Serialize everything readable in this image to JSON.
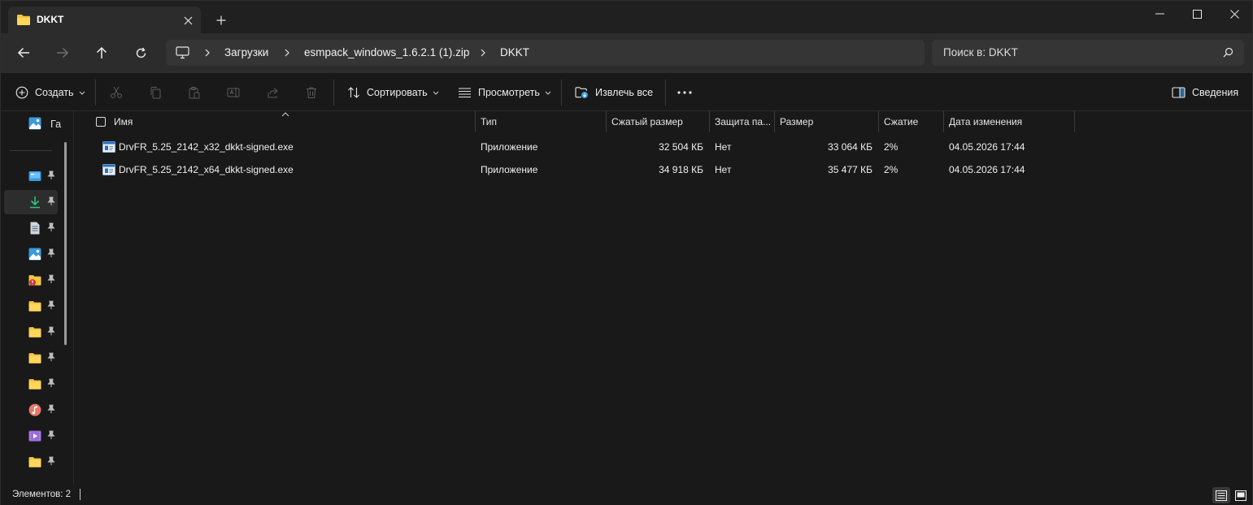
{
  "window": {
    "tab_title": "DKKT",
    "new_tab_symbol": "+"
  },
  "address": {
    "breadcrumbs": [
      "Загрузки",
      "esmpack_windows_1.6.2.1 (1).zip",
      "DKKT"
    ],
    "search_placeholder": "Поиск в: DKKT"
  },
  "commands": {
    "create": "Создать",
    "sort": "Сортировать",
    "view": "Просмотреть",
    "extract_all": "Извлечь все",
    "details": "Сведения"
  },
  "sidebar": {
    "gallery_label": "Га",
    "items": [
      {
        "icon": "desktop-icon",
        "color": "#3a9bdc"
      },
      {
        "icon": "downloads-icon",
        "color": "#2ec27e",
        "active": true
      },
      {
        "icon": "documents-icon",
        "color": "#cfd6e0"
      },
      {
        "icon": "pictures-icon",
        "color": "#3a9bdc"
      },
      {
        "icon": "folder-alert-icon",
        "color": "#f5c542"
      },
      {
        "icon": "folder-icon",
        "color": "#f5c542"
      },
      {
        "icon": "folder-icon",
        "color": "#f5c542"
      },
      {
        "icon": "folder-icon",
        "color": "#f5c542"
      },
      {
        "icon": "folder-icon",
        "color": "#f5c542"
      },
      {
        "icon": "music-icon",
        "color": "#e8786b"
      },
      {
        "icon": "videos-icon",
        "color": "#9b6bdc"
      },
      {
        "icon": "folder-icon",
        "color": "#f5c542"
      }
    ]
  },
  "columns": [
    "Имя",
    "Тип",
    "Сжатый размер",
    "Защита па...",
    "Размер",
    "Сжатие",
    "Дата изменения"
  ],
  "files": [
    {
      "name": "DrvFR_5.25_2142_x32_dkkt-signed.exe",
      "type": "Приложение",
      "packed": "32 504 КБ",
      "protected": "Нет",
      "size": "33 064 КБ",
      "ratio": "2%",
      "modified": "04.05.2026 17:44"
    },
    {
      "name": "DrvFR_5.25_2142_x64_dkkt-signed.exe",
      "type": "Приложение",
      "packed": "34 918 КБ",
      "protected": "Нет",
      "size": "35 477 КБ",
      "ratio": "2%",
      "modified": "04.05.2026 17:44"
    }
  ],
  "status": {
    "items_text": "Элементов: 2"
  },
  "colors": {
    "folder": "#f5c542",
    "accent_download": "#2ec27e"
  }
}
